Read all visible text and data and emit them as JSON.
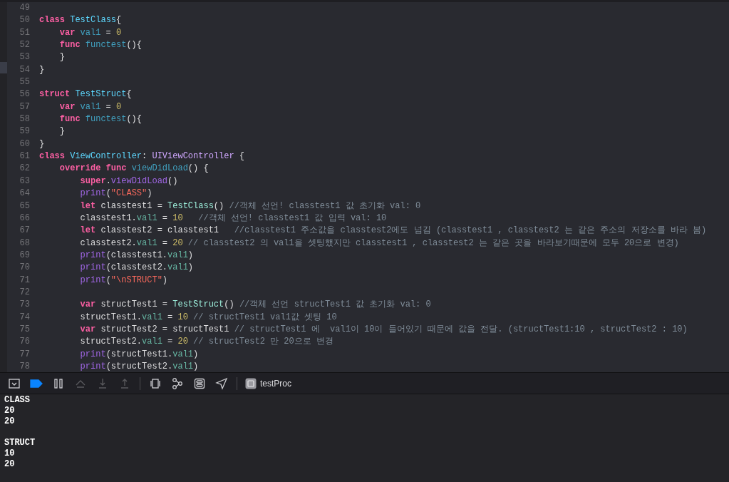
{
  "editor": {
    "lines": [
      {
        "number": "49"
      },
      {
        "number": "50",
        "tokens": [
          {
            "kind": "keyword",
            "text": "class "
          },
          {
            "kind": "typedecl",
            "text": "TestClass"
          },
          {
            "kind": "plain",
            "text": "{"
          }
        ]
      },
      {
        "number": "51",
        "tokens": [
          {
            "kind": "keyword",
            "text": "    var "
          },
          {
            "kind": "decl",
            "text": "val1"
          },
          {
            "kind": "plain",
            "text": " = "
          },
          {
            "kind": "number",
            "text": "0"
          }
        ]
      },
      {
        "number": "52",
        "tokens": [
          {
            "kind": "keyword",
            "text": "    func "
          },
          {
            "kind": "decl",
            "text": "functest"
          },
          {
            "kind": "plain",
            "text": "(){"
          }
        ]
      },
      {
        "number": "53",
        "tokens": [
          {
            "kind": "plain",
            "text": "    }"
          }
        ]
      },
      {
        "number": "54",
        "tokens": [
          {
            "kind": "plain",
            "text": "}"
          }
        ]
      },
      {
        "number": "55"
      },
      {
        "number": "56",
        "tokens": [
          {
            "kind": "keyword",
            "text": "struct "
          },
          {
            "kind": "typedecl",
            "text": "TestStruct"
          },
          {
            "kind": "plain",
            "text": "{"
          }
        ]
      },
      {
        "number": "57",
        "tokens": [
          {
            "kind": "keyword",
            "text": "    var "
          },
          {
            "kind": "decl",
            "text": "val1"
          },
          {
            "kind": "plain",
            "text": " = "
          },
          {
            "kind": "number",
            "text": "0"
          }
        ]
      },
      {
        "number": "58",
        "tokens": [
          {
            "kind": "keyword",
            "text": "    func "
          },
          {
            "kind": "decl",
            "text": "functest"
          },
          {
            "kind": "plain",
            "text": "(){"
          }
        ]
      },
      {
        "number": "59",
        "tokens": [
          {
            "kind": "plain",
            "text": "    }"
          }
        ]
      },
      {
        "number": "60",
        "tokens": [
          {
            "kind": "plain",
            "text": "}"
          }
        ]
      },
      {
        "number": "61",
        "tokens": [
          {
            "kind": "keyword",
            "text": "class "
          },
          {
            "kind": "typedecl",
            "text": "ViewController"
          },
          {
            "kind": "plain",
            "text": ": "
          },
          {
            "kind": "systype",
            "text": "UIViewController"
          },
          {
            "kind": "plain",
            "text": " {"
          }
        ]
      },
      {
        "number": "62",
        "tokens": [
          {
            "kind": "keyword",
            "text": "    override func "
          },
          {
            "kind": "decl",
            "text": "viewDidLoad"
          },
          {
            "kind": "plain",
            "text": "() {"
          }
        ]
      },
      {
        "number": "63",
        "tokens": [
          {
            "kind": "keyword",
            "text": "        super"
          },
          {
            "kind": "plain",
            "text": "."
          },
          {
            "kind": "call",
            "text": "viewDidLoad"
          },
          {
            "kind": "plain",
            "text": "()"
          }
        ]
      },
      {
        "number": "64",
        "tokens": [
          {
            "kind": "call",
            "text": "        print"
          },
          {
            "kind": "plain",
            "text": "("
          },
          {
            "kind": "string",
            "text": "\"CLASS\""
          },
          {
            "kind": "plain",
            "text": ")"
          }
        ]
      },
      {
        "number": "65",
        "tokens": [
          {
            "kind": "keyword",
            "text": "        let"
          },
          {
            "kind": "plain",
            "text": " classtest1 = "
          },
          {
            "kind": "typeref",
            "text": "TestClass"
          },
          {
            "kind": "plain",
            "text": "() "
          },
          {
            "kind": "comment",
            "text": "//객체 선언! classtest1 값 초기화 val: 0"
          }
        ]
      },
      {
        "number": "66",
        "tokens": [
          {
            "kind": "plain",
            "text": "        classtest1."
          },
          {
            "kind": "prop",
            "text": "val1"
          },
          {
            "kind": "plain",
            "text": " = "
          },
          {
            "kind": "number",
            "text": "10"
          },
          {
            "kind": "comment",
            "text": "   //객체 선언! classtest1 값 입력 val: 10"
          }
        ]
      },
      {
        "number": "67",
        "tokens": [
          {
            "kind": "keyword",
            "text": "        let"
          },
          {
            "kind": "plain",
            "text": " classtest2 = classtest1"
          },
          {
            "kind": "comment",
            "text": "   //classtest1 주소값을 classtest2에도 넘김 (classtest1 , classtest2 는 같은 주소의 저장소를 바라 봄)"
          }
        ]
      },
      {
        "number": "68",
        "tokens": [
          {
            "kind": "plain",
            "text": "        classtest2."
          },
          {
            "kind": "prop",
            "text": "val1"
          },
          {
            "kind": "plain",
            "text": " = "
          },
          {
            "kind": "number",
            "text": "20"
          },
          {
            "kind": "comment",
            "text": " // classtest2 의 val1을 셋팅했지만 classtest1 , classtest2 는 같은 곳을 바라보기때문에 모두 20으로 변경)"
          }
        ]
      },
      {
        "number": "69",
        "tokens": [
          {
            "kind": "call",
            "text": "        print"
          },
          {
            "kind": "plain",
            "text": "(classtest1."
          },
          {
            "kind": "prop",
            "text": "val1"
          },
          {
            "kind": "plain",
            "text": ")"
          }
        ]
      },
      {
        "number": "70",
        "tokens": [
          {
            "kind": "call",
            "text": "        print"
          },
          {
            "kind": "plain",
            "text": "(classtest2."
          },
          {
            "kind": "prop",
            "text": "val1"
          },
          {
            "kind": "plain",
            "text": ")"
          }
        ]
      },
      {
        "number": "71",
        "tokens": [
          {
            "kind": "call",
            "text": "        print"
          },
          {
            "kind": "plain",
            "text": "("
          },
          {
            "kind": "string",
            "text": "\"\\nSTRUCT\""
          },
          {
            "kind": "plain",
            "text": ")"
          }
        ]
      },
      {
        "number": "72"
      },
      {
        "number": "73",
        "tokens": [
          {
            "kind": "keyword",
            "text": "        var"
          },
          {
            "kind": "plain",
            "text": " structTest1 = "
          },
          {
            "kind": "typeref",
            "text": "TestStruct"
          },
          {
            "kind": "plain",
            "text": "() "
          },
          {
            "kind": "comment",
            "text": "//객체 선언 structTest1 값 초기화 val: 0"
          }
        ]
      },
      {
        "number": "74",
        "tokens": [
          {
            "kind": "plain",
            "text": "        structTest1."
          },
          {
            "kind": "prop",
            "text": "val1"
          },
          {
            "kind": "plain",
            "text": " = "
          },
          {
            "kind": "number",
            "text": "10"
          },
          {
            "kind": "comment",
            "text": " // structTest1 val1값 셋팅 10"
          }
        ]
      },
      {
        "number": "75",
        "tokens": [
          {
            "kind": "keyword",
            "text": "        var"
          },
          {
            "kind": "plain",
            "text": " structTest2 = structTest1 "
          },
          {
            "kind": "comment",
            "text": "// structTest1 에  val1이 10이 들어있기 때문에 값을 전달. (structTest1:10 , structTest2 : 10)"
          }
        ]
      },
      {
        "number": "76",
        "tokens": [
          {
            "kind": "plain",
            "text": "        structTest2."
          },
          {
            "kind": "prop",
            "text": "val1"
          },
          {
            "kind": "plain",
            "text": " = "
          },
          {
            "kind": "number",
            "text": "20"
          },
          {
            "kind": "comment",
            "text": " // structTest2 만 20으로 변경"
          }
        ]
      },
      {
        "number": "77",
        "tokens": [
          {
            "kind": "call",
            "text": "        print"
          },
          {
            "kind": "plain",
            "text": "(structTest1."
          },
          {
            "kind": "prop",
            "text": "val1"
          },
          {
            "kind": "plain",
            "text": ")"
          }
        ]
      },
      {
        "number": "78",
        "tokens": [
          {
            "kind": "call",
            "text": "        print"
          },
          {
            "kind": "plain",
            "text": "(structTest2."
          },
          {
            "kind": "prop",
            "text": "val1"
          },
          {
            "kind": "plain",
            "text": ")"
          }
        ]
      }
    ]
  },
  "debug_bar": {
    "buttons": [
      {
        "kind": "hide",
        "disabled": false
      },
      {
        "kind": "breakpoints",
        "disabled": false,
        "on": true
      },
      {
        "kind": "pause",
        "disabled": false
      },
      {
        "kind": "step_over",
        "disabled": true
      },
      {
        "kind": "step_into",
        "disabled": true
      },
      {
        "kind": "step_out",
        "disabled": true
      },
      {
        "kind": "separator"
      },
      {
        "kind": "view_debug",
        "disabled": false
      },
      {
        "kind": "memory_graph",
        "disabled": false
      },
      {
        "kind": "environment",
        "disabled": false
      },
      {
        "kind": "location",
        "disabled": false
      },
      {
        "kind": "separator"
      }
    ],
    "process": "testProc"
  },
  "console": {
    "blocks": [
      [
        "CLASS",
        "20",
        "20"
      ],
      [
        "STRUCT",
        "10",
        "20"
      ]
    ]
  }
}
